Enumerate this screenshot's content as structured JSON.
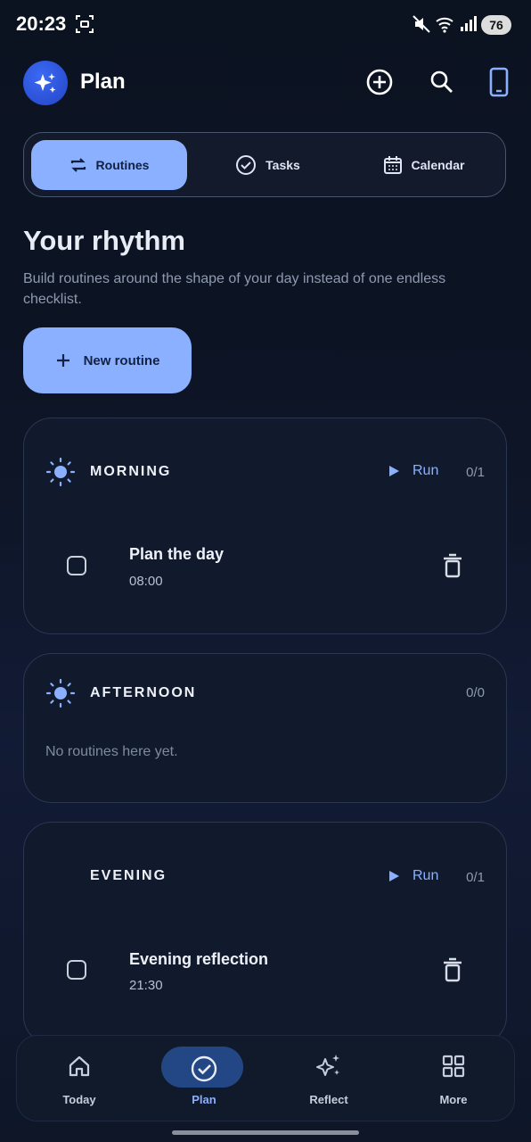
{
  "status_bar": {
    "time": "20:23",
    "battery": "76"
  },
  "app": {
    "title": "Plan"
  },
  "segments": [
    {
      "label": "Routines",
      "icon": "repeat-icon",
      "active": true
    },
    {
      "label": "Tasks",
      "icon": "check-circle-icon",
      "active": false
    },
    {
      "label": "Calendar",
      "icon": "calendar-icon",
      "active": false
    }
  ],
  "heading": "Your rhythm",
  "subheading": "Build routines around the shape of your day instead of one endless checklist.",
  "new_routine_label": "New routine",
  "cards": {
    "morning": {
      "title": "MORNING",
      "run_label": "Run",
      "count": "0/1",
      "items": [
        {
          "title": "Plan the day",
          "time": "08:00"
        }
      ]
    },
    "afternoon": {
      "title": "AFTERNOON",
      "count": "0/0",
      "empty_text": "No routines here yet."
    },
    "evening": {
      "title": "EVENING",
      "run_label": "Run",
      "count": "0/1",
      "items": [
        {
          "title": "Evening reflection",
          "time": "21:30"
        }
      ]
    }
  },
  "bottom_nav": [
    {
      "label": "Today",
      "icon": "home-icon",
      "active": false
    },
    {
      "label": "Plan",
      "icon": "check-circle-icon",
      "active": true
    },
    {
      "label": "Reflect",
      "icon": "sparkles-icon",
      "active": false
    },
    {
      "label": "More",
      "icon": "grid-icon",
      "active": false
    }
  ],
  "colors": {
    "accent": "#8ab0ff",
    "background": "#0d1526",
    "card": "#111a2c",
    "active_nav_pill": "#234785"
  }
}
